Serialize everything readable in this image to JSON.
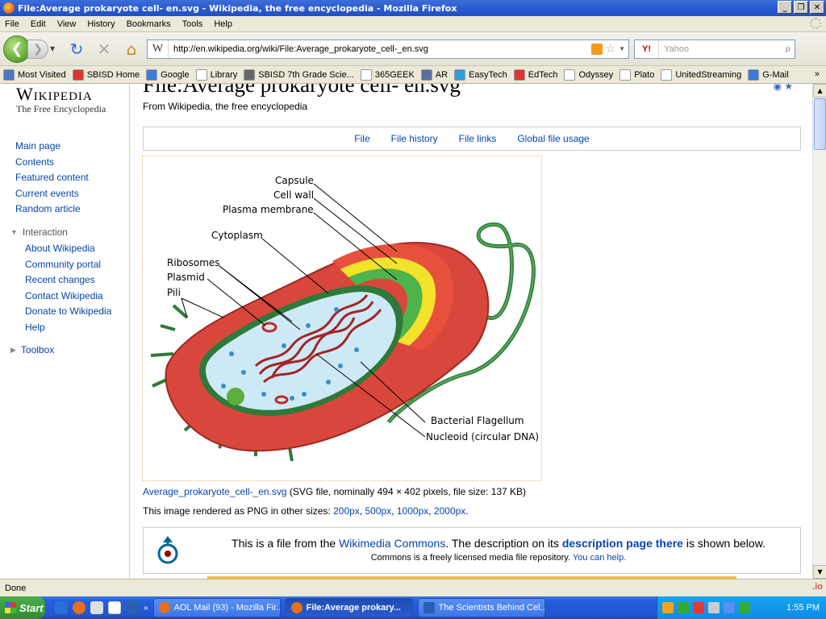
{
  "window": {
    "title": "File:Average prokaryote cell- en.svg - Wikipedia, the free encyclopedia - Mozilla Firefox"
  },
  "menu": [
    "File",
    "Edit",
    "View",
    "History",
    "Bookmarks",
    "Tools",
    "Help"
  ],
  "navbar": {
    "url": "http://en.wikipedia.org/wiki/File:Average_prokaryote_cell-_en.svg",
    "site_icon": "W",
    "search_engine": "Y!",
    "search_placeholder": "Yahoo"
  },
  "bookmarks": [
    {
      "label": "Most Visited",
      "color": "#4a78c2"
    },
    {
      "label": "SBISD Home",
      "color": "#d33"
    },
    {
      "label": "Google",
      "color": "#3a7be0"
    },
    {
      "label": "Library",
      "color": "#ffffff"
    },
    {
      "label": "SBISD 7th Grade Scie...",
      "color": "#666666"
    },
    {
      "label": "365GEEK",
      "color": "#ffffff"
    },
    {
      "label": "AR",
      "color": "#5a6fa0"
    },
    {
      "label": "EasyTech",
      "color": "#2aa0e0"
    },
    {
      "label": "EdTech",
      "color": "#d33"
    },
    {
      "label": "Odyssey",
      "color": "#ffffff"
    },
    {
      "label": "Plato",
      "color": "#ffffff"
    },
    {
      "label": "UnitedStreaming",
      "color": "#ffffff"
    },
    {
      "label": "G-Mail",
      "color": "#3a7be0"
    }
  ],
  "bookmarks_more": "»",
  "sidebar": {
    "logo_title": "Wikipedia",
    "logo_sub": "The Free Encyclopedia",
    "nav": [
      "Main page",
      "Contents",
      "Featured content",
      "Current events",
      "Random article"
    ],
    "interaction_head": "Interaction",
    "interaction": [
      "About Wikipedia",
      "Community portal",
      "Recent changes",
      "Contact Wikipedia",
      "Donate to Wikipedia",
      "Help"
    ],
    "toolbox_head": "Toolbox"
  },
  "main": {
    "title": "File:Average prokaryote cell- en.svg",
    "from": "From Wikipedia, the free encyclopedia",
    "tabs": [
      "File",
      "File history",
      "File links",
      "Global file usage"
    ],
    "diagram_labels": {
      "capsule": "Capsule",
      "cell_wall": "Cell wall",
      "plasma_membrane": "Plasma membrane",
      "cytoplasm": "Cytoplasm",
      "ribosomes": "Ribosomes",
      "plasmid": "Plasmid",
      "pili": "Pili",
      "flagellum": "Bacterial Flagellum",
      "nucleoid": "Nucleoid (circular DNA)"
    },
    "caption_link": "Average_prokaryote_cell-_en.svg",
    "caption_rest": "(SVG file, nominally 494 × 402 pixels, file size: 137 KB)",
    "sizes_prefix": "This image rendered as PNG in other sizes:",
    "sizes": [
      "200px",
      "500px",
      "1000px",
      "2000px"
    ],
    "commons": {
      "t1": "This is a file from the ",
      "link1": "Wikimedia Commons",
      "t2": ". The description on its ",
      "link2": "description page there",
      "t3": " is shown below.",
      "line2": "Commons is a freely licensed media file repository. ",
      "line2_link": "You can help."
    }
  },
  "status": "Done",
  "status_right": ".io",
  "taskbar": {
    "start": "Start",
    "tasks": [
      {
        "label": "AOL Mail (93) - Mozilla Fir...",
        "active": false
      },
      {
        "label": "File:Average prokary...",
        "active": true
      },
      {
        "label": "The Scientists Behind Cel...",
        "active": false
      }
    ],
    "clock": "1:55 PM"
  }
}
